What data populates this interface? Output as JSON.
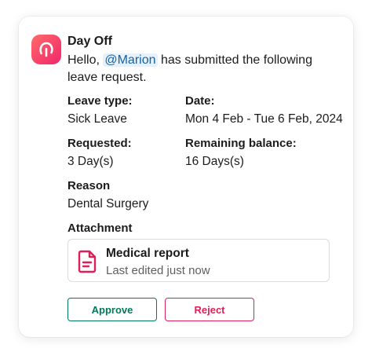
{
  "app": {
    "name": "Day Off",
    "avatar_icon": "day-off-logo-icon",
    "accent": "#f0266b"
  },
  "message": {
    "greeting": "Hello,",
    "mention": "@Marion",
    "text": "has submitted the following leave request."
  },
  "fields": {
    "leave_type": {
      "label": "Leave type:",
      "value": "Sick Leave"
    },
    "date": {
      "label": "Date:",
      "value": "Mon 4 Feb - Tue 6 Feb, 2024"
    },
    "requested": {
      "label": "Requested:",
      "value": "3 Day(s)"
    },
    "remaining": {
      "label": "Remaining balance:",
      "value": "16 Days(s)"
    },
    "reason": {
      "label": "Reason",
      "value": "Dental Surgery"
    }
  },
  "attachment": {
    "label": "Attachment",
    "title": "Medical report",
    "subtitle": "Last edited just now",
    "icon": "document-icon"
  },
  "actions": {
    "approve": {
      "label": "Approve",
      "color": "#007a5a"
    },
    "reject": {
      "label": "Reject",
      "color": "#e01e5a"
    }
  }
}
